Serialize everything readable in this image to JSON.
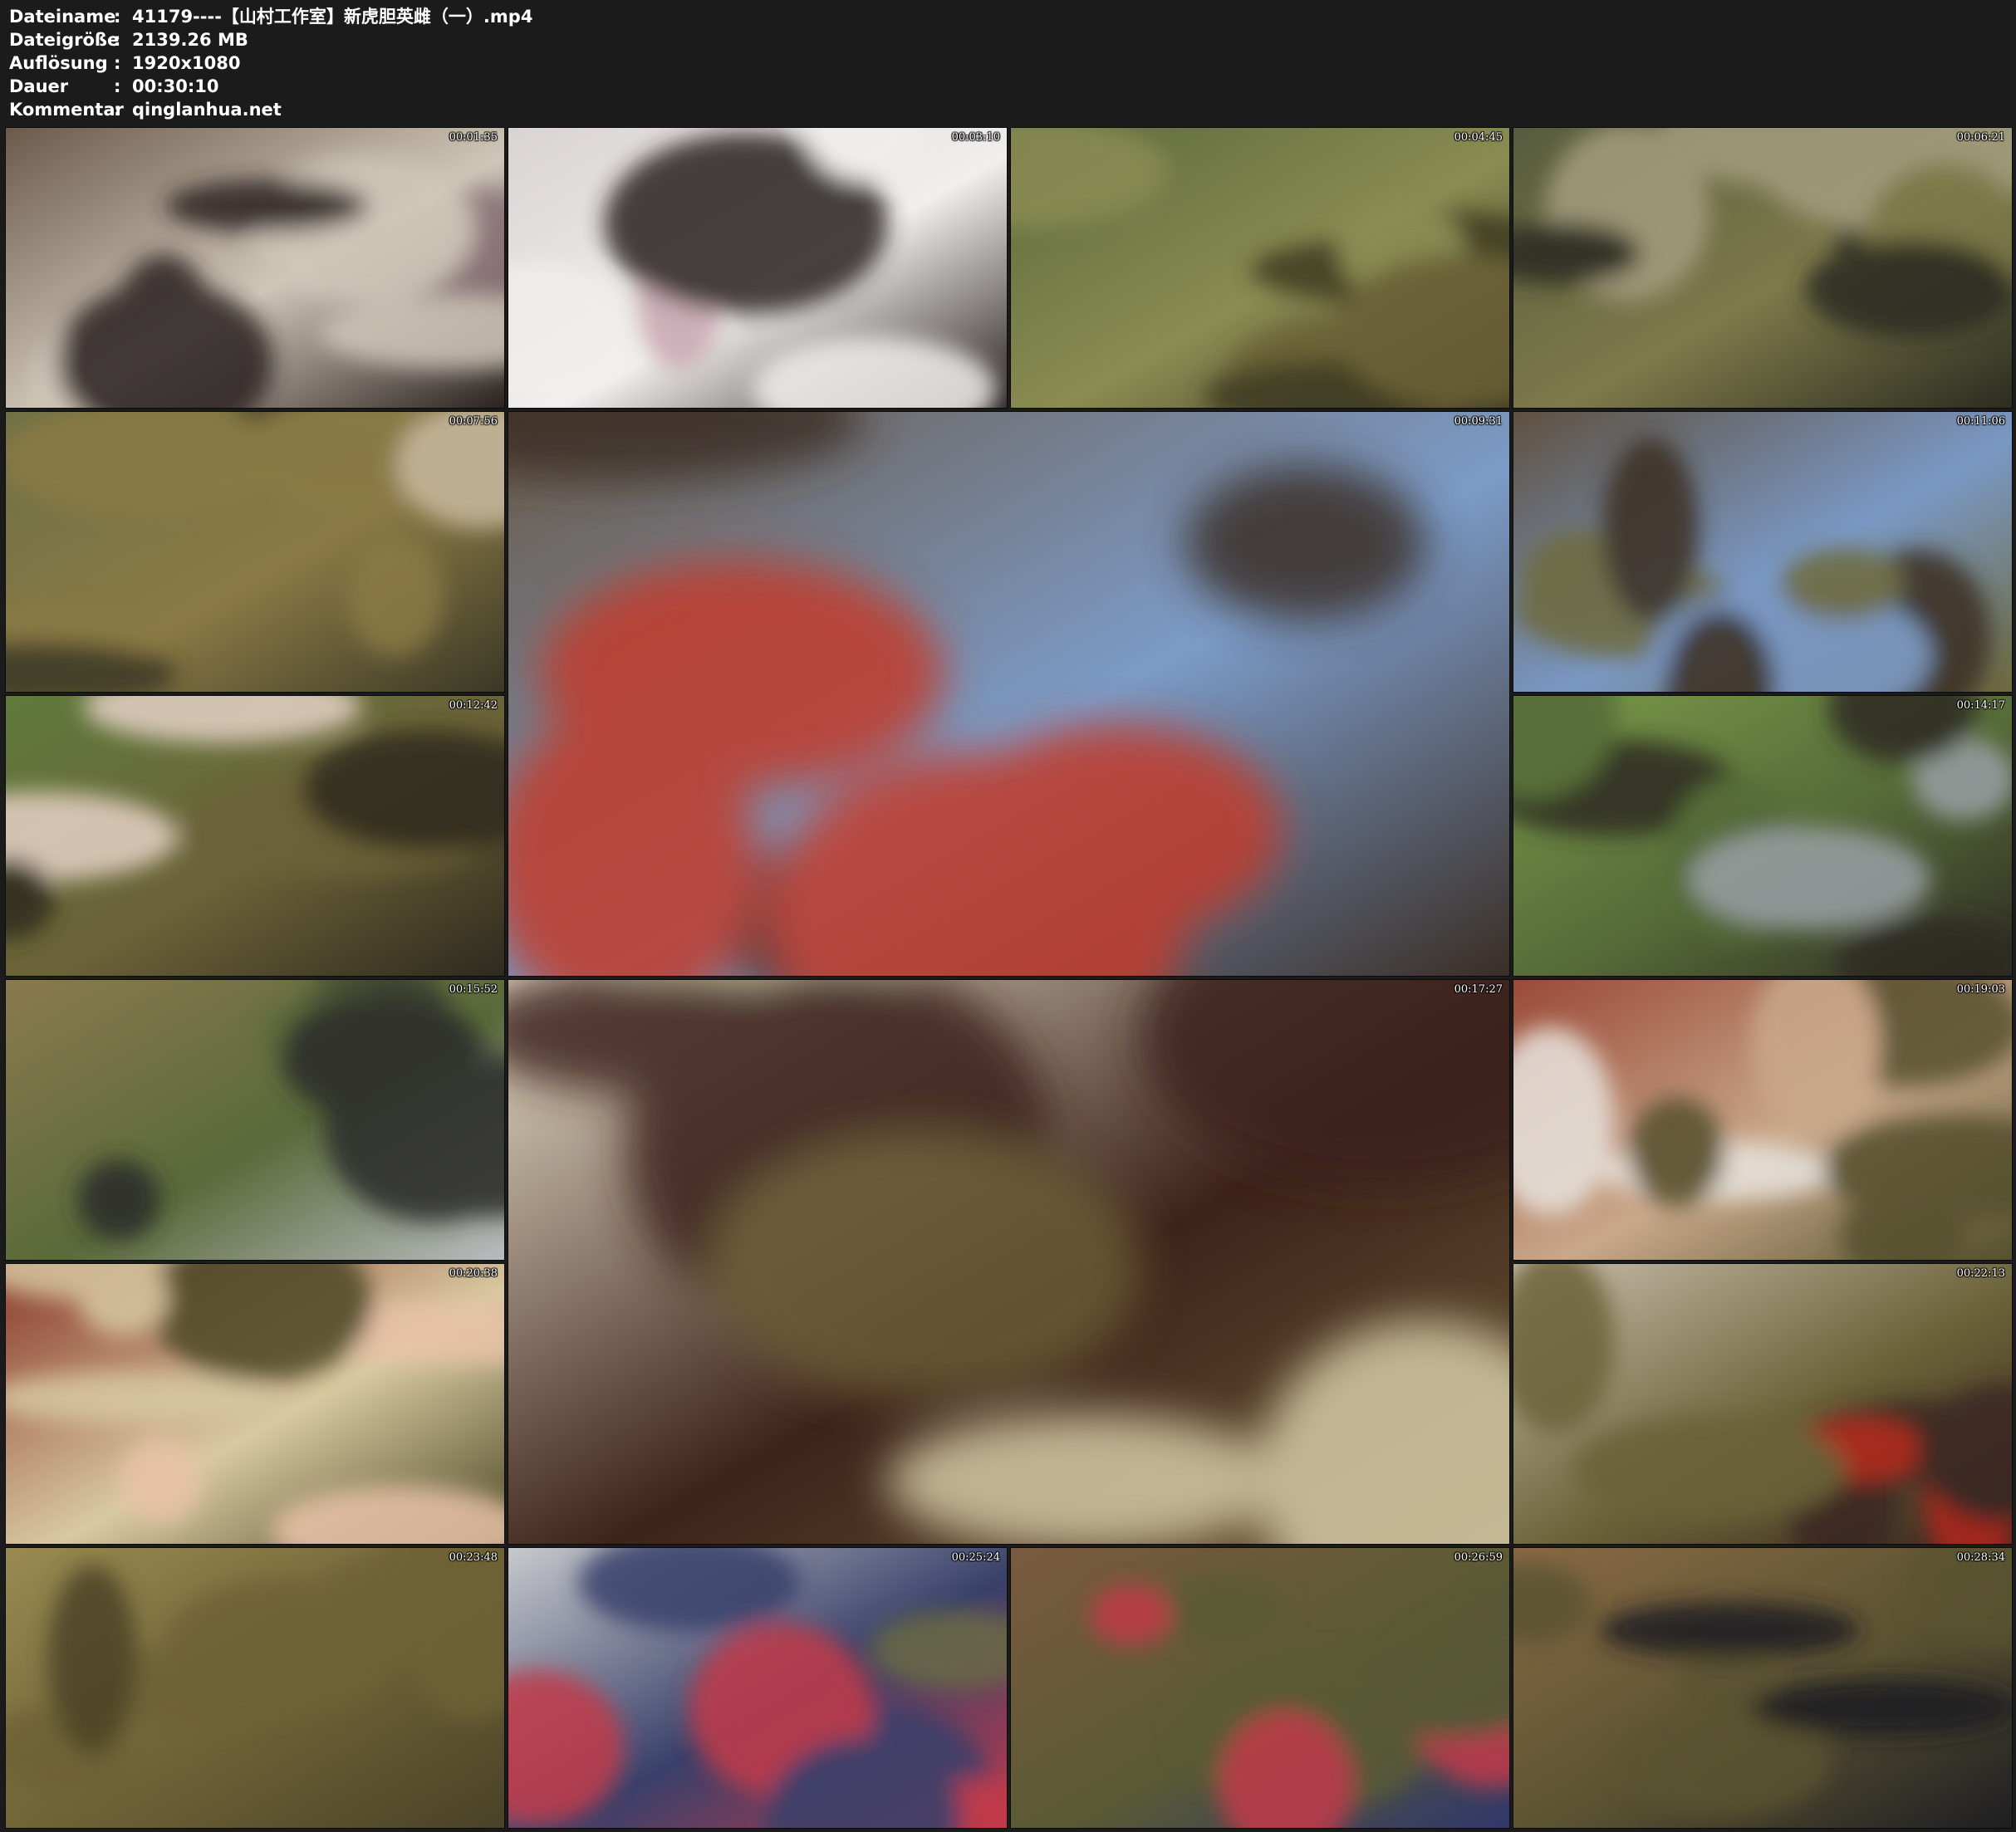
{
  "header": {
    "rows": [
      {
        "label": "Dateiname",
        "sep": ":",
        "value": "41179----【山村工作室】新虎胆英雌（一）.mp4"
      },
      {
        "label": "Dateigröße",
        "sep": ":",
        "value": "2139.26 MB"
      },
      {
        "label": "Auflösung",
        "sep": ":",
        "value": "1920x1080"
      },
      {
        "label": "Dauer",
        "sep": ":",
        "value": "00:30:10"
      },
      {
        "label": "Kommentar",
        "sep": ":",
        "value": "qinglanhua.net"
      }
    ]
  },
  "thumbnails": [
    {
      "time": "00:01:35",
      "palette": [
        "#6b5a4a",
        "#cfc6b8",
        "#2a2320",
        "#8a6f78"
      ]
    },
    {
      "time": "00:03:10",
      "palette": [
        "#d9d4d2",
        "#f1eeee",
        "#2b2222",
        "#c8a5b0"
      ]
    },
    {
      "time": "00:04:45",
      "palette": [
        "#5c6a3a",
        "#8a8c52",
        "#3d3a22",
        "#6b6036"
      ]
    },
    {
      "time": "00:06:21",
      "palette": [
        "#565c3e",
        "#7d7a4a",
        "#2c2c20",
        "#a49d80"
      ]
    },
    {
      "time": "00:07:56",
      "palette": [
        "#6d7046",
        "#8b7a45",
        "#3a3826",
        "#c9b9a0"
      ]
    },
    {
      "time": "00:09:31",
      "palette": [
        "#6b5a48",
        "#7c9bc7",
        "#3a2e26",
        "#c23a2a"
      ]
    },
    {
      "time": "00:11:06",
      "palette": [
        "#5f5140",
        "#7a98c4",
        "#6e6a3e",
        "#3a2e24"
      ]
    },
    {
      "time": "00:12:42",
      "palette": [
        "#607a3c",
        "#6c6238",
        "#2e2a1e",
        "#e6d2c6"
      ]
    },
    {
      "time": "00:14:17",
      "palette": [
        "#7a9a4a",
        "#556a38",
        "#2e2a22",
        "#9aa0a6"
      ]
    },
    {
      "time": "00:15:52",
      "palette": [
        "#8a7a4e",
        "#5a6a3a",
        "#b8bcbf",
        "#2a2a2a"
      ]
    },
    {
      "time": "00:17:27",
      "palette": [
        "#e5ddc8",
        "#3d231a",
        "#6b5a36",
        "#d4c9a6"
      ]
    },
    {
      "time": "00:19:03",
      "palette": [
        "#9a4a38",
        "#c9a88a",
        "#54502e",
        "#e8e4de"
      ]
    },
    {
      "time": "00:20:38",
      "palette": [
        "#8a3a2c",
        "#d8c9a0",
        "#4e4a28",
        "#e8c2a8"
      ]
    },
    {
      "time": "00:22:13",
      "palette": [
        "#c9bfae",
        "#6a6238",
        "#3a2820",
        "#b4261e"
      ]
    },
    {
      "time": "00:23:48",
      "palette": [
        "#9a8a52",
        "#6e6236",
        "#4a4228",
        "#c7b884"
      ]
    },
    {
      "time": "00:25:24",
      "palette": [
        "#c7c9cb",
        "#39406a",
        "#c23a4a",
        "#6b6a44"
      ]
    },
    {
      "time": "00:26:59",
      "palette": [
        "#7a5a3e",
        "#5a5a34",
        "#30386a",
        "#c23a4a"
      ]
    },
    {
      "time": "00:28:34",
      "palette": [
        "#8a6a44",
        "#5a5232",
        "#1e1e22",
        "#f2f2f2"
      ]
    }
  ]
}
